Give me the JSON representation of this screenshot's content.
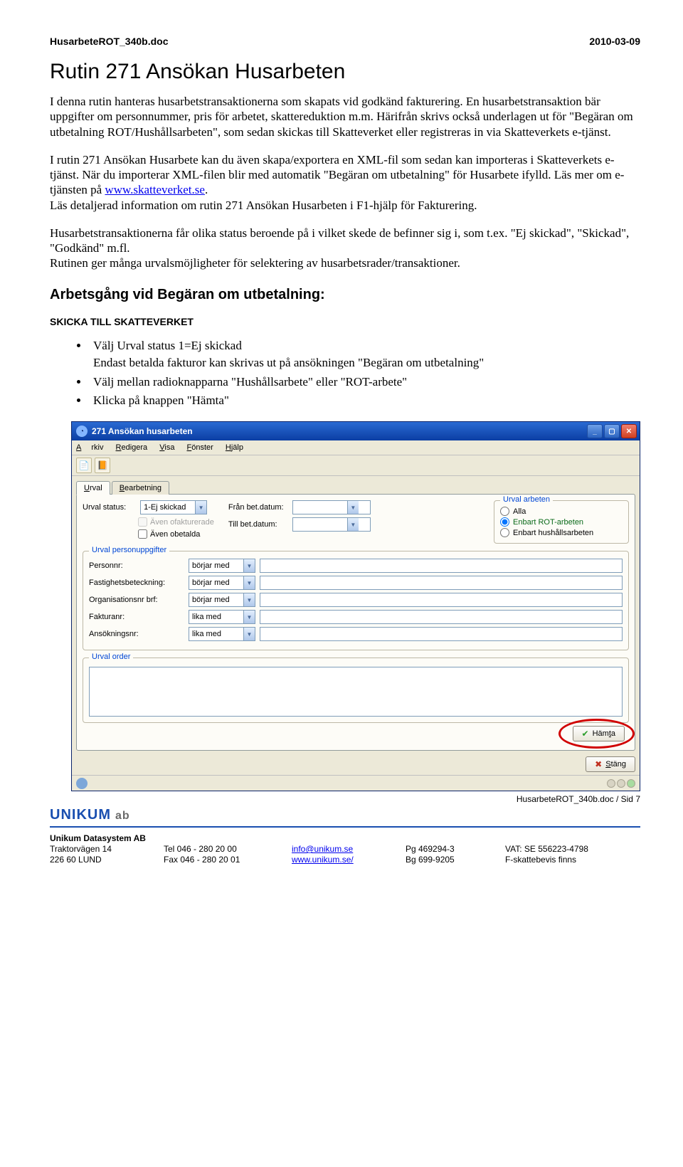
{
  "header": {
    "doc": "HusarbeteROT_340b.doc",
    "date": "2010-03-09"
  },
  "title": "Rutin 271 Ansökan Husarbeten",
  "para1": "I denna rutin hanteras husarbetstransaktionerna som skapats vid godkänd fakturering. En husarbetstransaktion bär uppgifter om personnummer, pris för arbetet, skattereduktion m.m. Härifrån skrivs också underlagen ut för \"Begäran om utbetalning ROT/Hushållsarbeten\", som sedan skickas till Skatteverket eller registreras in via Skatteverkets e-tjänst.",
  "para2a": "I rutin 271 Ansökan Husarbete kan du även skapa/exportera en XML-fil som sedan kan importeras i Skatteverkets e-tjänst. När du importerar XML-filen blir med automatik \"Begäran om utbetalning\" för Husarbete ifylld. Läs mer om e-tjänsten på ",
  "para2link": "www.skatteverket.se",
  "para2b": "Läs detaljerad information om rutin 271 Ansökan Husarbeten i F1-hjälp för Fakturering.",
  "para3": "Husarbetstransaktionerna får olika status beroende på i vilket skede de befinner sig i, som t.ex. \"Ej skickad\", \"Skickad\", \"Godkänd\" m.fl.",
  "para4": "Rutinen ger många urvalsmöjligheter för selektering av husarbetsrader/transaktioner.",
  "h2": "Arbetsgång vid Begäran om utbetalning:",
  "h3": "SKICKA TILL SKATTEVERKET",
  "bullets": [
    "Välj Urval status 1=Ej skickad",
    "Endast betalda fakturor kan skrivas ut på ansökningen \"Begäran om utbetalning\"",
    "Välj mellan radioknapparna \"Hushållsarbete\" eller \"ROT-arbete\"",
    "Klicka på knappen \"Hämta\""
  ],
  "app": {
    "title": "271 Ansökan husarbeten",
    "menu": {
      "arkiv": "Arkiv",
      "redigera": "Redigera",
      "visa": "Visa",
      "fonster": "Fönster",
      "hjalp": "Hjälp"
    },
    "tabs": {
      "urval": "Urval",
      "bearbetning": "Bearbetning"
    },
    "urval_status_label": "Urval status:",
    "urval_status_value": "1-Ej skickad",
    "chk_ofakturerade": "Även ofakturerade",
    "chk_obetalda": "Även obetalda",
    "fran_datum": "Från bet.datum:",
    "till_datum": "Till bet.datum:",
    "radio_legend": "Urval arbeten",
    "radio_alla": "Alla",
    "radio_rot": "Enbart ROT-arbeten",
    "radio_hush": "Enbart hushållsarbeten",
    "fs_person_legend": "Urval personuppgifter",
    "personnr": "Personnr:",
    "fastighet": "Fastighetsbeteckning:",
    "orgnr": "Organisationsnr brf:",
    "fakturanr": "Fakturanr:",
    "ansokningsnr": "Ansökningsnr:",
    "op_borjar": "börjar med",
    "op_lika": "lika med",
    "fs_order_legend": "Urval order",
    "btn_hamta": "Hämta",
    "btn_stang": "Stäng"
  },
  "footer": {
    "ref": "HusarbeteROT_340b.doc / Sid 7",
    "brand": "UNIKUM",
    "brand_ab": "ab",
    "company": "Unikum Datasystem AB",
    "addr1": "Traktorvägen 14",
    "addr2": "226 60  LUND",
    "tel": "Tel  046 - 280 20 00",
    "fax": "Fax  046 - 280 20 01",
    "email": "info@unikum.se",
    "web": "www.unikum.se/",
    "pg": "Pg   469294-3",
    "bg": "Bg  699-9205",
    "vat": "VAT: SE 556223-4798",
    "fskatt": "F-skattebevis finns"
  }
}
